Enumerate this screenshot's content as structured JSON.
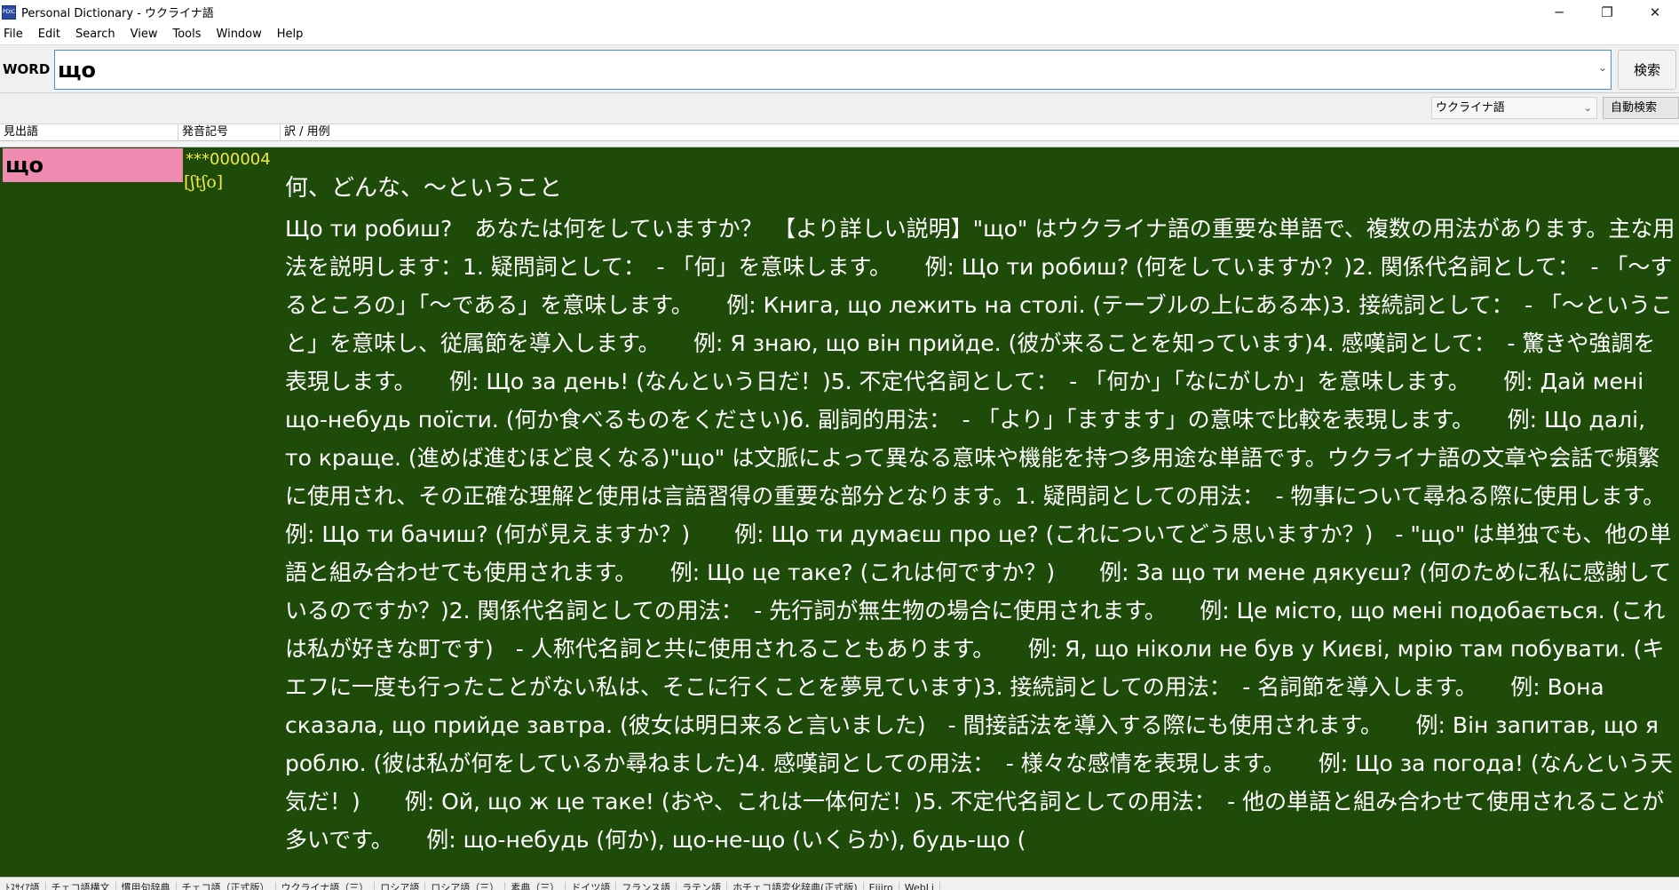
{
  "window": {
    "title": "Personal Dictionary - ウクライナ語",
    "app_icon_text": "PDIC",
    "minimize_glyph": "─",
    "restore_glyph": "❐",
    "close_glyph": "✕"
  },
  "menu": {
    "items": [
      "File",
      "Edit",
      "Search",
      "View",
      "Tools",
      "Window",
      "Help"
    ]
  },
  "search": {
    "label": "WORD",
    "value": "що",
    "button_label": "検索"
  },
  "language": {
    "selected": "ウクライナ語",
    "auto_search_label": "自動検索"
  },
  "columns": {
    "headword": "見出語",
    "pronunciation": "発音記号",
    "translation": "訳 / 用例"
  },
  "entry": {
    "headword": "що",
    "record_id": "***000004",
    "pronunciation": "[ʃtʃo]",
    "translation": "何、どんな、～ということ",
    "example": "Що ти робиш?　あなたは何をしていますか？　【より詳しい説明】\"що\" はウクライナ語の重要な単語で、複数の用法があります。主な用法を説明します：1. 疑問詞として：　- 「何」を意味します。　　例: Що ти робиш? (何をしていますか？)2. 関係代名詞として：　- 「～するところの」「～である」を意味します。　　例: Книга, що лежить на столі. (テーブルの上にある本)3. 接続詞として：　- 「～ということ」を意味し、従属節を導入します。　　例: Я знаю, що він прийде. (彼が来ることを知っています)4. 感嘆詞として：　- 驚きや強調を表現します。　　例: Що за день! (なんという日だ！)5. 不定代名詞として：　- 「何か」「なにがしか」を意味します。　　例: Дай мені що-небудь поїсти. (何か食べるものをください)6. 副詞的用法：　- 「より」「ますます」の意味で比較を表現します。　　例: Що далі, то краще. (進めば進むほど良くなる)\"що\" は文脈によって異なる意味や機能を持つ多用途な単語です。ウクライナ語の文章や会話で頻繁に使用され、その正確な理解と使用は言語習得の重要な部分となります。1. 疑問詞としての用法：　- 物事について尋ねる際に使用します。　　例: Що ти бачиш? (何が見えますか？)　　例: Що ти думаєш про це? (これについてどう思いますか？)　- \"що\" は単独でも、他の単語と組み合わせても使用されます。　　例: Що це таке? (これは何ですか？)　　例: За що ти мене дякуєш? (何のために私に感謝しているのですか？)2. 関係代名詞としての用法：　- 先行詞が無生物の場合に使用されます。　　例: Це місто, що мені подобається. (これは私が好きな町です)　- 人称代名詞と共に使用されることもあります。　　例: Я, що ніколи не був у Києві, мрію там побувати. (キエフに一度も行ったことがない私は、そこに行くことを夢見ています)3. 接続詞としての用法：　- 名詞節を導入します。　　例: Вона сказала, що прийде завтра. (彼女は明日来ると言いました)　- 間接話法を導入する際にも使用されます。　　例: Він запитав, що я роблю. (彼は私が何をしているか尋ねました)4. 感嘆詞としての用法：　- 様々な感情を表現します。　　例: Що за погода! (なんという天気だ！)　　例: Ой, що ж це таке! (おや、これは一体何だ！)5. 不定代名詞としての用法：　- 他の単語と組み合わせて使用されることが多いです。　　例: що-небудь (何か), що-не-що (いくらか), будь-що ("
  },
  "tabs": [
    "ﾄｽｻｲｱ語",
    "チェコ語構文",
    "慣用句辞典",
    "チェコ語（正式版）",
    "ウクライナ語（三）",
    "ロシア語",
    "ロシア語（三）",
    "素典（三）",
    "ドイツ語",
    "フランス語",
    "ラテン語",
    "ホチェコ語変化辞典(正式版)",
    "Eijiro",
    "WebLi"
  ]
}
